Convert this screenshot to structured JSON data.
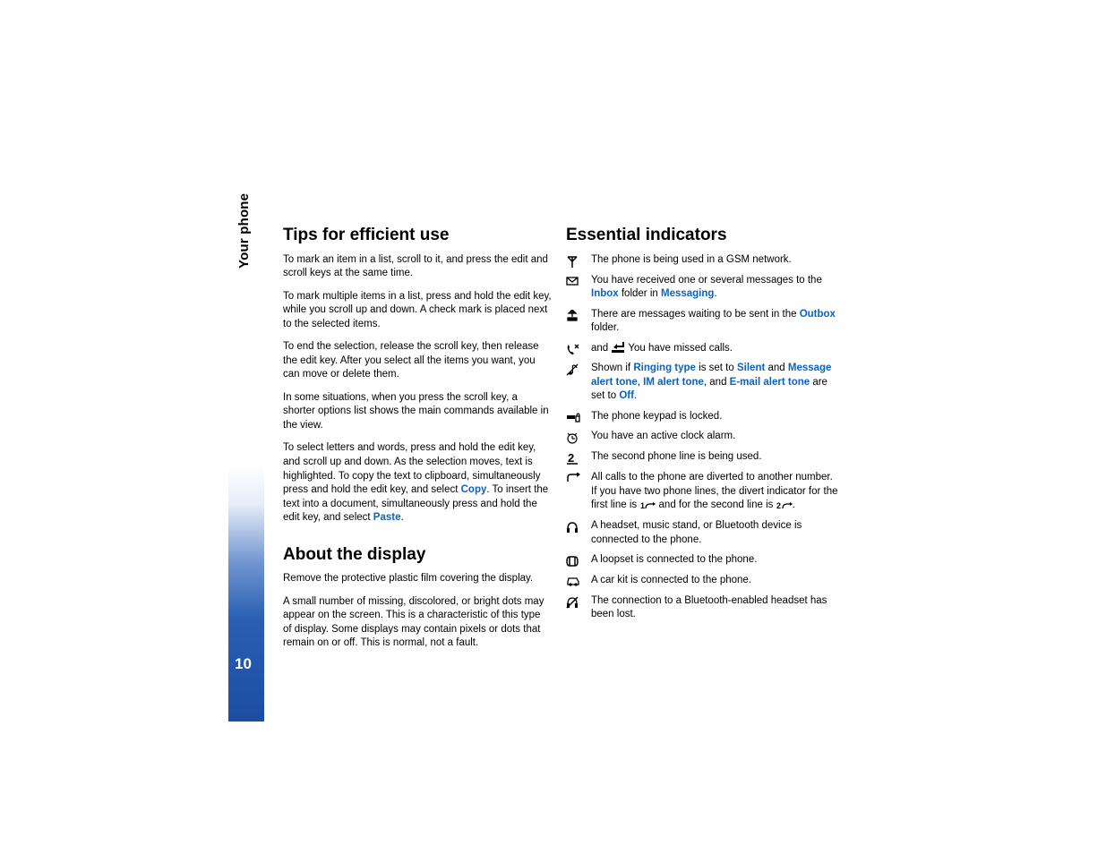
{
  "sidebar": {
    "section_label": "Your phone",
    "page_number": "10"
  },
  "left": {
    "tips_heading": "Tips for efficient use",
    "tips_p1": "To mark an item in a list, scroll to it, and press the edit and scroll keys at the same time.",
    "tips_p2": "To mark multiple items in a list, press and hold the edit key, while you scroll up and down. A check mark is placed next to the selected items.",
    "tips_p3": "To end the selection, release the scroll key, then release the edit key. After you select all the items you want, you can move or delete them.",
    "tips_p4": "In some situations, when you press the scroll key, a shorter options list shows the main commands available in the view.",
    "tips_p5_a": "To select letters and words, press and hold the edit key, and scroll up and down. As the selection moves, text is highlighted. To copy the text to clipboard, simultaneously press and hold the edit key, and select ",
    "copy": "Copy",
    "tips_p5_b": ". To insert the text into a document, simultaneously press and hold the edit key, and select ",
    "paste": "Paste",
    "tips_p5_c": ".",
    "about_heading": "About the display",
    "about_p1": "Remove the protective plastic film covering the display.",
    "about_p2": "A small number of missing, discolored, or bright dots may appear on the screen. This is a characteristic of this type of display. Some displays may contain pixels or dots that remain on or off. This is normal, not a fault."
  },
  "right": {
    "heading": "Essential indicators",
    "r0": "The phone is being used in a GSM network.",
    "r1_a": "You have received one or several messages to the ",
    "inbox": "Inbox",
    "r1_b": " folder in ",
    "messaging": "Messaging",
    "r1_c": ".",
    "r2_a": "There are messages waiting to be sent in the ",
    "outbox": "Outbox",
    "r2_b": " folder.",
    "r3_a": "and ",
    "r3_b": " You have missed calls.",
    "r4_a": "Shown if ",
    "ringing_type": "Ringing type",
    "r4_b": " is set to ",
    "silent": "Silent",
    "r4_c": " and ",
    "message_alert": "Message alert tone",
    "r4_d": ", ",
    "im_alert": "IM alert tone",
    "r4_e": ", and ",
    "email_alert": "E-mail alert tone",
    "r4_f": " are set to ",
    "off": "Off",
    "r4_g": ".",
    "r5": "The phone keypad is locked.",
    "r6": "You have an active clock alarm.",
    "r7": "The second phone line is being used.",
    "r8_a": "All calls to the phone are diverted to another number. If you have two phone lines, the divert indicator for the first line is ",
    "r8_b": " and for the second line is ",
    "r8_c": ".",
    "r9": "A headset, music stand, or Bluetooth device is connected to the phone.",
    "r10": "A loopset is connected to the phone.",
    "r11": "A car kit is connected to the phone.",
    "r12": "The connection to a Bluetooth-enabled headset has been lost."
  }
}
